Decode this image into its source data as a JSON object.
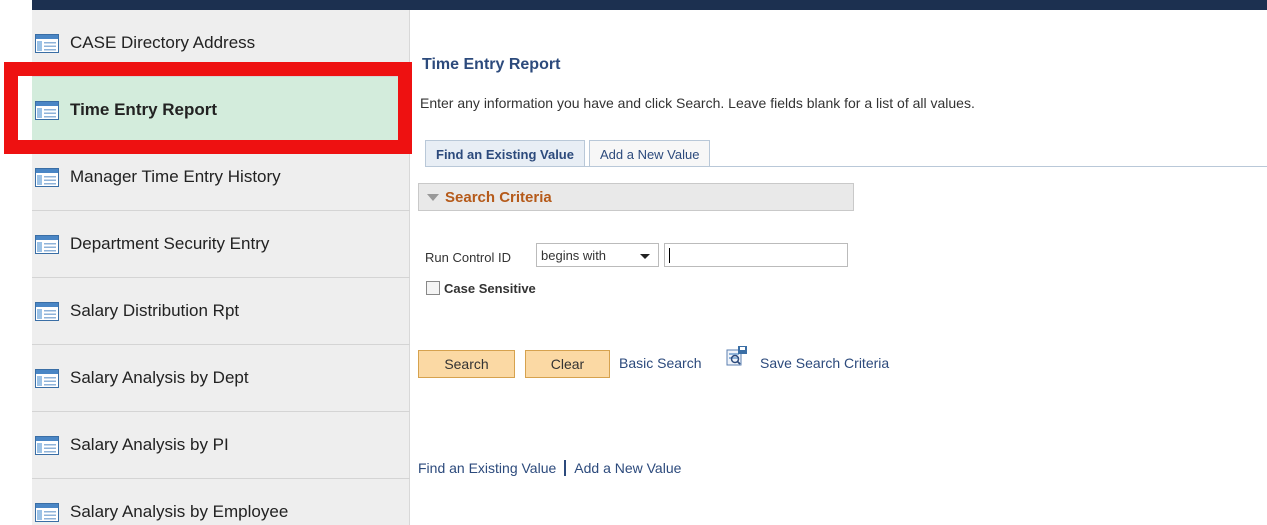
{
  "sidebar": {
    "items": [
      {
        "label": "CASE Directory Address"
      },
      {
        "label": "Time Entry Report",
        "active": true
      },
      {
        "label": "Manager Time Entry History"
      },
      {
        "label": "Department Security Entry"
      },
      {
        "label": "Salary Distribution Rpt"
      },
      {
        "label": "Salary Analysis by Dept"
      },
      {
        "label": "Salary Analysis by PI"
      },
      {
        "label": "Salary Analysis by Employee"
      }
    ]
  },
  "main": {
    "title": "Time Entry Report",
    "instructions": "Enter any information you have and click Search. Leave fields blank for a list of all values.",
    "tabs": [
      {
        "label": "Find an Existing Value"
      },
      {
        "label": "Add a New Value"
      }
    ],
    "search_criteria": {
      "title": "Search Criteria",
      "run_control_label": "Run Control ID",
      "operator": "begins with",
      "value": "",
      "case_sensitive_label": "Case Sensitive"
    },
    "buttons": {
      "search": "Search",
      "clear": "Clear",
      "basic_search": "Basic Search",
      "save_search": "Save Search Criteria"
    },
    "bottom_links": {
      "find": "Find an Existing Value",
      "add": "Add a New Value"
    }
  },
  "colors": {
    "header_bar": "#1c3050",
    "highlight": "#ee1111",
    "active_item": "#d3ecdc",
    "link": "#2c4a7c",
    "criteria_title": "#b55a1a",
    "button": "#fbd9a4"
  }
}
